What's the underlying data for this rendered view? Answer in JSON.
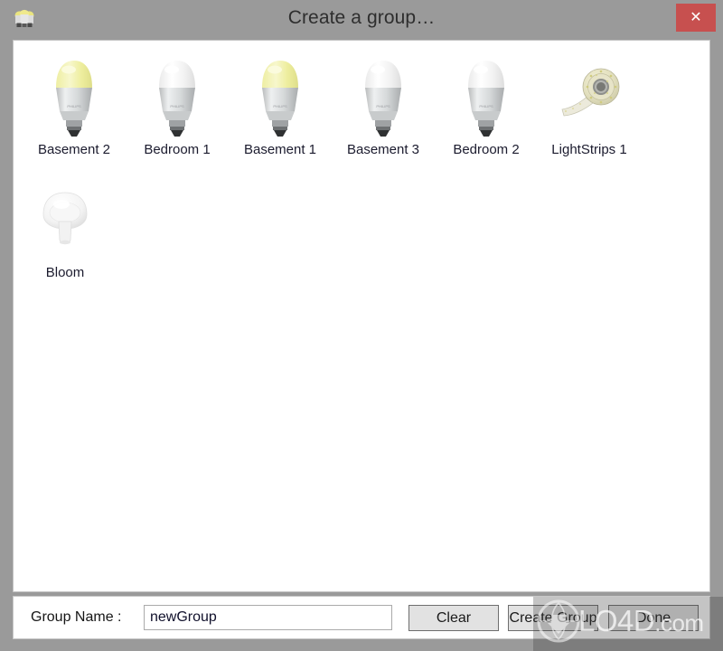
{
  "window": {
    "title": "Create a group…",
    "title_icon": "light-bulbs-group-icon",
    "close_label": "✕",
    "titlebar_color": "#9a9a9a",
    "close_button_color": "#c7504f",
    "panel_background": "#ffffff"
  },
  "devices": [
    {
      "name": "Basement 2",
      "icon": "hue-bulb-icon",
      "state": "on",
      "glow_color": "#f2f2b0"
    },
    {
      "name": "Bedroom 1",
      "icon": "hue-bulb-icon",
      "state": "off",
      "glow_color": "#f4f4f4"
    },
    {
      "name": "Basement 1",
      "icon": "hue-bulb-icon",
      "state": "on",
      "glow_color": "#f2f2b0"
    },
    {
      "name": "Basement 3",
      "icon": "hue-bulb-icon",
      "state": "off",
      "glow_color": "#f4f4f4"
    },
    {
      "name": "Bedroom 2",
      "icon": "hue-bulb-icon",
      "state": "off",
      "glow_color": "#f4f4f4"
    },
    {
      "name": "LightStrips 1",
      "icon": "hue-lightstrip-icon",
      "state": "off",
      "glow_color": "#e9e6d2"
    },
    {
      "name": "Bloom",
      "icon": "hue-bloom-icon",
      "state": "off",
      "glow_color": "#f1f1f1"
    }
  ],
  "bottom_bar": {
    "group_name_label": "Group Name :",
    "group_name_value": "newGroup",
    "group_name_placeholder": "",
    "clear_label": "Clear",
    "create_group_label": "Create Group",
    "done_label": "Done"
  },
  "watermark": {
    "text": "LO4D",
    "suffix": ".com",
    "logo": "lo4d-globe-download-logo"
  }
}
